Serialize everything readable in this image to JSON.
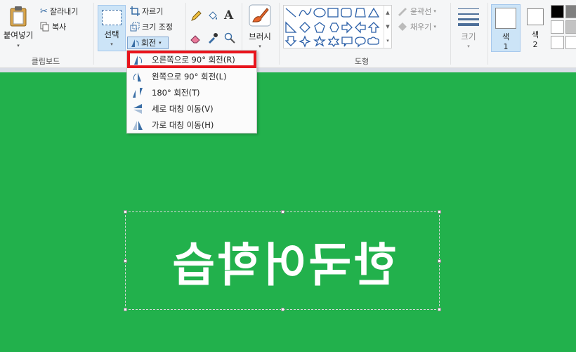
{
  "clipboard": {
    "paste_label": "붙여넣기",
    "cut_label": "잘라내기",
    "copy_label": "복사",
    "group_label": "클립보드"
  },
  "image": {
    "select_label": "선택",
    "crop_label": "자르기",
    "resize_label": "크기 조정",
    "rotate_label": "회전"
  },
  "tools": {
    "brush_label": "브러시"
  },
  "shapes": {
    "outline_label": "윤곽선",
    "fill_label": "채우기",
    "group_label": "도형"
  },
  "size": {
    "label": "크기"
  },
  "colors": {
    "color1_label": "색\n1",
    "color1_top": "색",
    "color1_num": "1",
    "color2_top": "색",
    "color2_num": "2",
    "canvas_bg": "#22b14c",
    "palette": [
      "#000000",
      "#7f7f7f",
      "#ffffff",
      "#c3c3c3",
      "#ffffff",
      "#ffffff"
    ]
  },
  "rotate_menu": {
    "items": [
      {
        "label": "오른쪽으로 90° 회전(R)",
        "highlighted": true
      },
      {
        "label": "왼쪽으로 90° 회전(L)"
      },
      {
        "label": "180° 회전(T)"
      },
      {
        "label": "세로 대칭 이동(V)"
      },
      {
        "label": "가로 대칭 이동(H)"
      }
    ]
  },
  "canvas": {
    "text": "한국어학습"
  }
}
